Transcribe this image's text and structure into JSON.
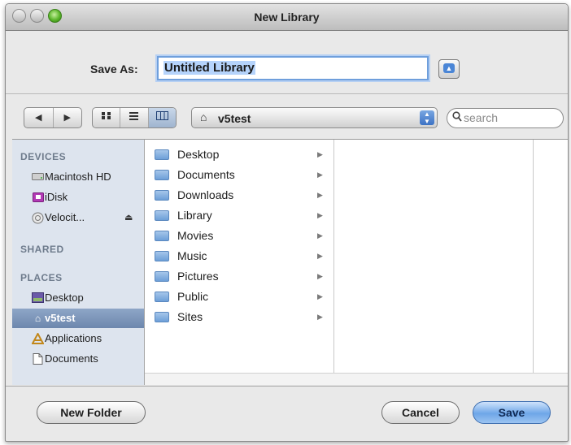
{
  "window": {
    "title": "New Library"
  },
  "save_as": {
    "label": "Save As:",
    "value": "Untitled Library"
  },
  "toolbar": {
    "back_glyph": "◀",
    "forward_glyph": "▶",
    "view_icons": [
      "icon-view-icon",
      "list-view-icon",
      "column-view-icon"
    ],
    "location": "v5test",
    "search_placeholder": "search"
  },
  "sidebar": {
    "devices_heading": "DEVICES",
    "devices": [
      {
        "label": "Macintosh HD",
        "icon": "hard-disk-icon"
      },
      {
        "label": "iDisk",
        "icon": "idisk-icon"
      },
      {
        "label": "Velocit...",
        "icon": "network-volume-icon",
        "eject": "⏏"
      }
    ],
    "shared_heading": "SHARED",
    "places_heading": "PLACES",
    "places": [
      {
        "label": "Desktop",
        "icon": "desktop-icon"
      },
      {
        "label": "v5test",
        "icon": "home-icon",
        "selected": true
      },
      {
        "label": "Applications",
        "icon": "applications-icon"
      },
      {
        "label": "Documents",
        "icon": "documents-icon"
      }
    ]
  },
  "column1": {
    "items": [
      "Desktop",
      "Documents",
      "Downloads",
      "Library",
      "Movies",
      "Music",
      "Pictures",
      "Public",
      "Sites"
    ]
  },
  "buttons": {
    "new_folder": "New Folder",
    "cancel": "Cancel",
    "save": "Save"
  },
  "colors": {
    "selection": "#6d87ad",
    "field_focus": "#6f9fdc",
    "default_button": "#6ea6e8"
  }
}
